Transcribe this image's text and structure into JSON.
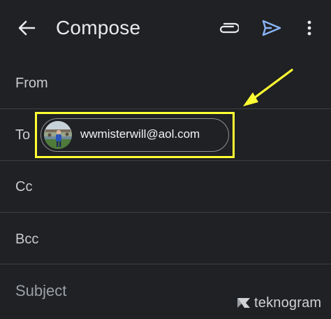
{
  "appbar": {
    "title": "Compose",
    "icons": [
      "back-arrow-icon",
      "paperclip-icon",
      "send-icon",
      "more-vert-icon"
    ],
    "send_color": "#8ab4f8"
  },
  "fields": {
    "from_label": "From",
    "to_label": "To",
    "cc_label": "Cc",
    "bcc_label": "Bcc",
    "subject_placeholder": "Subject"
  },
  "recipient_chip": {
    "email": "wwmisterwill@aol.com"
  },
  "annotation": {
    "color": "#ffff33"
  },
  "watermark": {
    "text": "teknogram"
  }
}
